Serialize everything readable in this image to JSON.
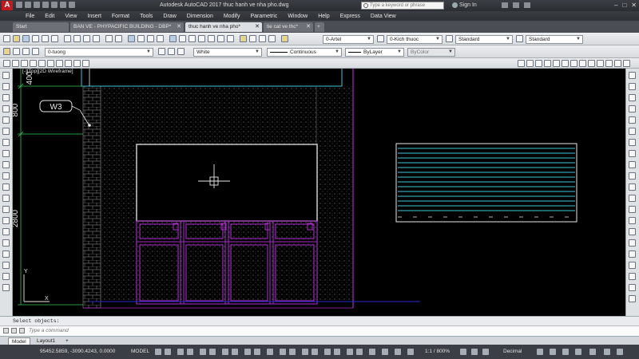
{
  "titlebar": {
    "app_logo": "A",
    "title": "Autodesk AutoCAD 2017   thuc hanh ve nha pho.dwg",
    "search_placeholder": "Type a keyword or phrase",
    "signin": "Sign In",
    "window_buttons": [
      "–",
      "□",
      "✕"
    ]
  },
  "menu": [
    "File",
    "Edit",
    "View",
    "Insert",
    "Format",
    "Tools",
    "Draw",
    "Dimension",
    "Modify",
    "Parametric",
    "Window",
    "Help",
    "Express",
    "Data View"
  ],
  "doc_tabs": [
    {
      "label": "Start",
      "active": false
    },
    {
      "label": "BAN VE - PHYPACIFIC BUILDING - DBP*",
      "active": false
    },
    {
      "label": "thuc hanh ve nha pho*",
      "active": true
    },
    {
      "label": "tie cat ve thc*",
      "active": false
    }
  ],
  "toolbar1": {
    "annotative": "0-Artel",
    "dim_style": "0-Kich thuoc",
    "text_style": "Standard",
    "table_style": "Standard"
  },
  "toolbar2": {
    "layer": "0-tuong",
    "color": "White",
    "linetype": "Continuous",
    "lineweight": "ByLayer",
    "plotstyle": "ByColor"
  },
  "drawing": {
    "viewport_label": "[-][Top][2D Wireframe]",
    "tag_label": "W3",
    "dims": [
      "400",
      "800",
      "2800"
    ],
    "ucs_y": "Y",
    "ucs_x": "X"
  },
  "command": {
    "history": "Select objects:",
    "placeholder": "Type a command"
  },
  "layout_tabs": [
    {
      "label": "Model",
      "active": true
    },
    {
      "label": "Layout1",
      "active": false
    }
  ],
  "statusbar": {
    "coords": "95452.5859, -3090.4243, 0.0000",
    "mode": "MODEL",
    "scale": "1:1 / 800%",
    "units": "Decimal"
  },
  "colors": {
    "brick_line": "#5a5a5a",
    "cyan": "#43c6d6",
    "magenta": "#a22ac0",
    "dim_green": "#35c65a",
    "white_frame": "#e8e8e8"
  }
}
